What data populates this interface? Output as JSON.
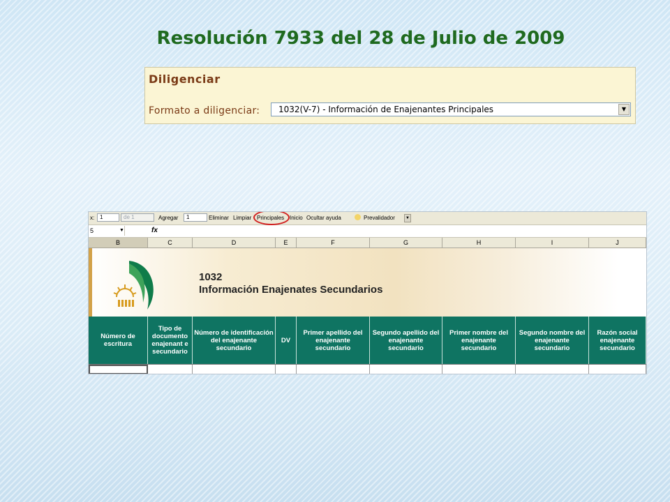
{
  "slide": {
    "title": "Resolución 7933 del 28 de Julio de 2009"
  },
  "diligenciar": {
    "heading": "Diligenciar",
    "format_label": "Formato a diligenciar:",
    "format_selected": "1032(V-7) - Información de Enajenantes Principales"
  },
  "sheet": {
    "toolbar": {
      "prefix": "x:",
      "record_value": "1",
      "record_total": "de 1",
      "add_label": "Agregar",
      "add_value": "1",
      "delete_label": "Eliminar",
      "clear_label": "Limpiar",
      "principales_label": "Principales",
      "inicio_label": "Inicio",
      "hide_help_label": "Ocultar ayuda",
      "prevalidator_label": "Prevalidador"
    },
    "formula_bar": {
      "name_box": "5",
      "fx": "fx"
    },
    "columns": [
      "B",
      "C",
      "D",
      "E",
      "F",
      "G",
      "H",
      "I",
      "J"
    ],
    "banner": {
      "code": "1032",
      "title": "Información Enajenates Secundarios"
    },
    "headers": [
      "Número de escritura",
      "Tipo de documento enajenant e secundario",
      "Número de identificación del enajenante secundario",
      "DV",
      "Primer apellido del enajenante secundario",
      "Segundo apellido del enajenante secundario",
      "Primer nombre del enajenante secundario",
      "Segundo nombre del enajenante secundario",
      "Razón social enajenante secundario"
    ]
  },
  "colors": {
    "title_green": "#1f6a1f",
    "header_teal": "#0f7462",
    "panel_bg": "#fbf5d4",
    "panel_text": "#7a3a16",
    "highlight_red": "#d21f1f"
  }
}
